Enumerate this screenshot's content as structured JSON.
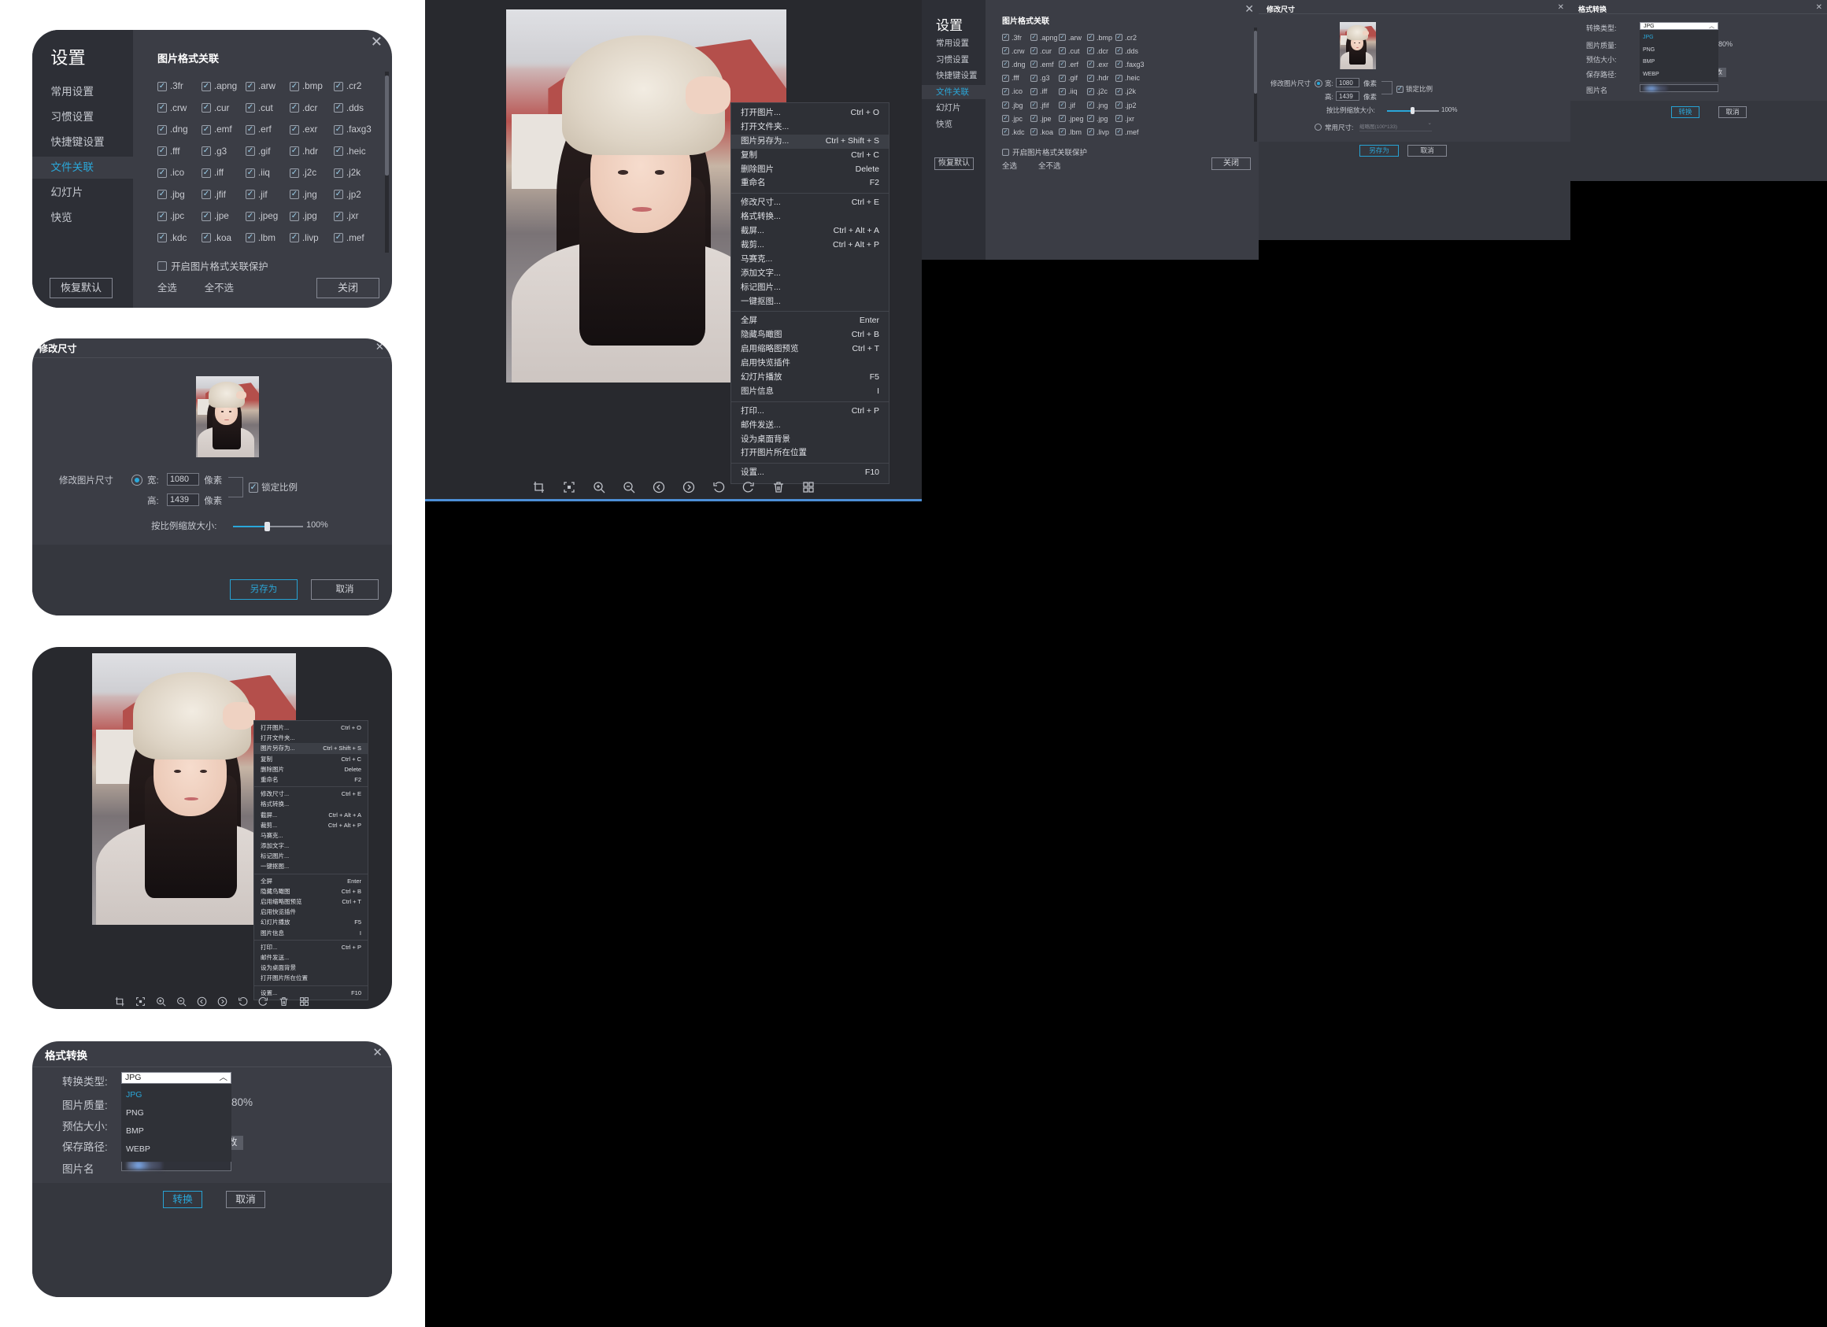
{
  "colors": {
    "accent": "#2aa7d9",
    "dialog_bg": "#3b3d45",
    "sidebar_bg": "#2d2f36",
    "viewer_bg": "#28292e"
  },
  "settings": {
    "title": "设置",
    "nav": [
      "常用设置",
      "习惯设置",
      "快捷键设置",
      "文件关联",
      "幻灯片",
      "快览"
    ],
    "active_nav": "文件关联",
    "section_title": "图片格式关联",
    "extensions": [
      ".3fr",
      ".apng",
      ".arw",
      ".bmp",
      ".cr2",
      ".crw",
      ".cur",
      ".cut",
      ".dcr",
      ".dds",
      ".dng",
      ".emf",
      ".erf",
      ".exr",
      ".faxg3",
      ".fff",
      ".g3",
      ".gif",
      ".hdr",
      ".heic",
      ".ico",
      ".iff",
      ".iiq",
      ".j2c",
      ".j2k",
      ".jbg",
      ".jfif",
      ".jif",
      ".jng",
      ".jp2",
      ".jpc",
      ".jpe",
      ".jpeg",
      ".jpg",
      ".jxr",
      ".kdc",
      ".koa",
      ".lbm",
      ".livp",
      ".mef"
    ],
    "protect_label": "开启图片格式关联保护",
    "protect_checked": false,
    "select_all": "全选",
    "select_none": "全不选",
    "reset_button": "恢复默认",
    "close_button": "关闭",
    "close_icon": "close-icon"
  },
  "resize": {
    "title": "修改尺寸",
    "size_label": "修改图片尺寸",
    "width_label": "宽:",
    "width_value": "1080",
    "height_label": "高:",
    "height_value": "1439",
    "unit": "像素",
    "lock_label": "锁定比例",
    "lock_checked": true,
    "scale_label": "按比例缩放大小:",
    "scale_value": "100%",
    "scale_fraction": 0.5,
    "preset_label": "常用尺寸:",
    "preset_value": "缩略图(100*133)",
    "save_button": "另存为",
    "cancel_button": "取消"
  },
  "context_menu": {
    "groups": [
      [
        {
          "label": "打开图片...",
          "shortcut": "Ctrl + O"
        },
        {
          "label": "打开文件夹...",
          "shortcut": ""
        },
        {
          "label": "图片另存为...",
          "shortcut": "Ctrl + Shift + S",
          "highlight": true
        },
        {
          "label": "复制",
          "shortcut": "Ctrl + C"
        },
        {
          "label": "删除图片",
          "shortcut": "Delete"
        },
        {
          "label": "重命名",
          "shortcut": "F2"
        }
      ],
      [
        {
          "label": "修改尺寸...",
          "shortcut": "Ctrl + E"
        },
        {
          "label": "格式转换...",
          "shortcut": ""
        },
        {
          "label": "截屏...",
          "shortcut": "Ctrl + Alt + A"
        },
        {
          "label": "裁剪...",
          "shortcut": "Ctrl + Alt + P"
        },
        {
          "label": "马赛克...",
          "shortcut": ""
        },
        {
          "label": "添加文字...",
          "shortcut": ""
        },
        {
          "label": "标记图片...",
          "shortcut": ""
        },
        {
          "label": "一键抠图...",
          "shortcut": ""
        }
      ],
      [
        {
          "label": "全屏",
          "shortcut": "Enter"
        },
        {
          "label": "隐藏鸟瞰图",
          "shortcut": "Ctrl + B"
        },
        {
          "label": "启用缩略图预览",
          "shortcut": "Ctrl + T"
        },
        {
          "label": "启用快览插件",
          "shortcut": ""
        },
        {
          "label": "幻灯片播放",
          "shortcut": "F5"
        },
        {
          "label": "图片信息",
          "shortcut": "I"
        }
      ],
      [
        {
          "label": "打印...",
          "shortcut": "Ctrl + P"
        },
        {
          "label": "邮件发送...",
          "shortcut": ""
        },
        {
          "label": "设为桌面背景",
          "shortcut": ""
        },
        {
          "label": "打开图片所在位置",
          "shortcut": ""
        }
      ],
      [
        {
          "label": "设置...",
          "shortcut": "F10"
        }
      ]
    ]
  },
  "toolbar": {
    "icons": [
      "crop-icon",
      "fit-icon",
      "zoom-in-icon",
      "zoom-out-icon",
      "previous-icon",
      "next-icon",
      "rotate-left-icon",
      "rotate-right-icon",
      "delete-icon",
      "grid-icon"
    ]
  },
  "convert": {
    "title": "格式转换",
    "type_label": "转换类型:",
    "type_value": "JPG",
    "options": [
      "JPG",
      "PNG",
      "BMP",
      "WEBP"
    ],
    "quality_label": "图片质量:",
    "quality_tail": "80%",
    "estimate_label": "预估大小:",
    "path_label": "保存路径:",
    "path_button_tail": "改",
    "image_label": "图片名",
    "convert_button": "转换",
    "cancel_button": "取消"
  }
}
